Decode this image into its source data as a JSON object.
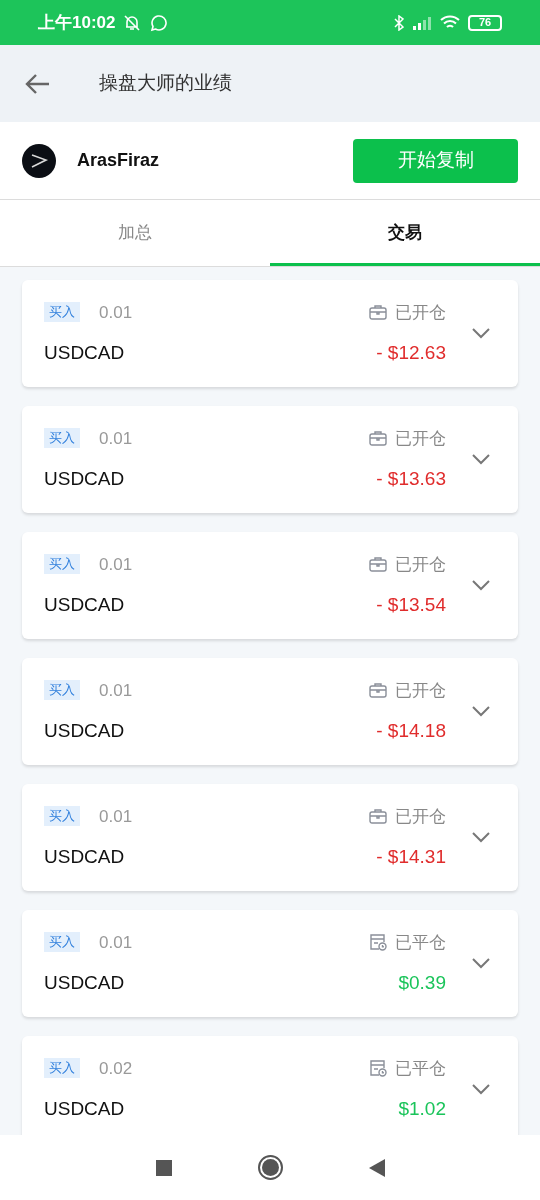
{
  "status_bar": {
    "time": "上午10:02",
    "battery": "76"
  },
  "header": {
    "title": "操盘大师的业绩"
  },
  "trader": {
    "name": "ArasFiraz",
    "button": "开始复制"
  },
  "tabs": [
    {
      "label": "加总",
      "selected": false
    },
    {
      "label": "交易",
      "selected": true
    }
  ],
  "trades": [
    {
      "side": "买入",
      "volume": "0.01",
      "symbol": "USDCAD",
      "kind": "open",
      "status": "已开仓",
      "color": "#e02c2c",
      "pnl": "- $12.63"
    },
    {
      "side": "买入",
      "volume": "0.01",
      "symbol": "USDCAD",
      "kind": "open",
      "status": "已开仓",
      "color": "#e02c2c",
      "pnl": "- $13.63"
    },
    {
      "side": "买入",
      "volume": "0.01",
      "symbol": "USDCAD",
      "kind": "open",
      "status": "已开仓",
      "color": "#e02c2c",
      "pnl": "- $13.54"
    },
    {
      "side": "买入",
      "volume": "0.01",
      "symbol": "USDCAD",
      "kind": "open",
      "status": "已开仓",
      "color": "#e02c2c",
      "pnl": "- $14.18"
    },
    {
      "side": "买入",
      "volume": "0.01",
      "symbol": "USDCAD",
      "kind": "open",
      "status": "已开仓",
      "color": "#e02c2c",
      "pnl": "- $14.31"
    },
    {
      "side": "买入",
      "volume": "0.01",
      "symbol": "USDCAD",
      "kind": "closed",
      "status": "已平仓",
      "color": "#1ac45a",
      "pnl": "$0.39"
    },
    {
      "side": "买入",
      "volume": "0.02",
      "symbol": "USDCAD",
      "kind": "closed",
      "status": "已平仓",
      "color": "#1ac45a",
      "pnl": "$1.02"
    }
  ]
}
